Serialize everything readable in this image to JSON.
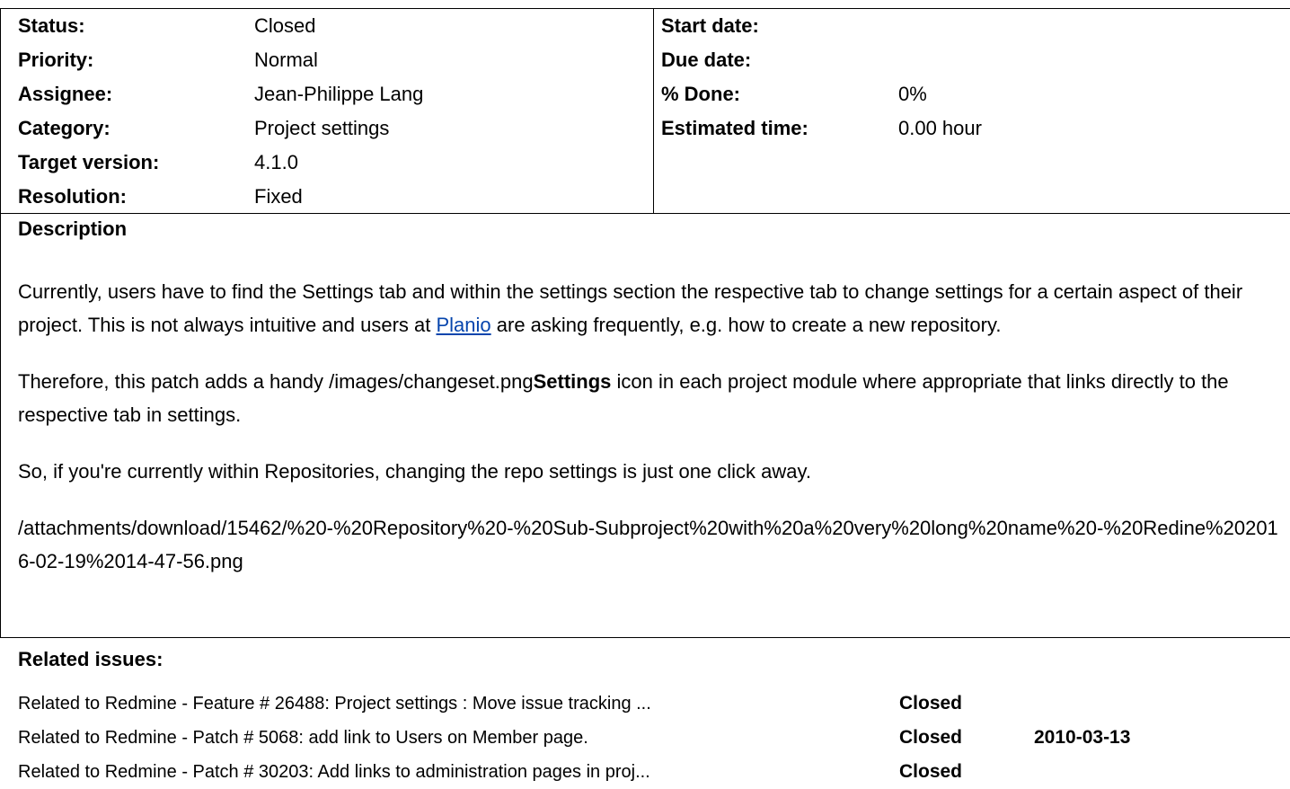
{
  "attributes": {
    "left": [
      {
        "label": "Status:",
        "value": "Closed"
      },
      {
        "label": "Priority:",
        "value": "Normal"
      },
      {
        "label": "Assignee:",
        "value": "Jean-Philippe Lang"
      },
      {
        "label": "Category:",
        "value": "Project settings"
      },
      {
        "label": "Target version:",
        "value": "4.1.0"
      },
      {
        "label": "Resolution:",
        "value": "Fixed"
      }
    ],
    "right": [
      {
        "label": "Start date:",
        "value": ""
      },
      {
        "label": "Due date:",
        "value": ""
      },
      {
        "label": "% Done:",
        "value": "0%"
      },
      {
        "label": "Estimated time:",
        "value": "0.00 hour"
      }
    ]
  },
  "description": {
    "heading": "Description",
    "p1_before": "Currently, users have to find the Settings tab and within the settings section the respective tab to change settings for a certain aspect of their project. This is not always intuitive and users at ",
    "p1_link": "Planio",
    "p1_after": " are asking frequently, e.g. how to create a new repository.",
    "p2_before": "Therefore, this patch adds a handy /images/changeset.png",
    "p2_bold": "Settings",
    "p2_after": " icon in each project module where appropriate that links directly to the respective tab in settings.",
    "p3": "So, if you're currently within Repositories, changing the repo settings is just one click away.",
    "p4": "/attachments/download/15462/%20-%20Repository%20-%20Sub-Subproject%20with%20a%20very%20long%20name%20-%20Redine%202016-02-19%2014-47-56.png"
  },
  "related": {
    "heading": "Related issues:",
    "items": [
      {
        "subject": "Related to Redmine - Feature # 26488: Project settings : Move issue tracking ...",
        "status": "Closed",
        "date": ""
      },
      {
        "subject": "Related to Redmine - Patch # 5068: add link to Users on Member page.",
        "status": "Closed",
        "date": "2010-03-13"
      },
      {
        "subject": "Related to Redmine - Patch # 30203: Add links to administration pages in proj...",
        "status": "Closed",
        "date": ""
      }
    ]
  }
}
